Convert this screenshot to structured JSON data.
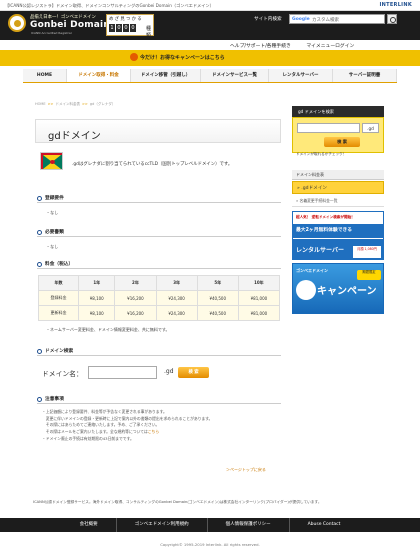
{
  "topbar": {
    "text": "【ICANN公認レジストラ】ドメイン取得、ドメインコンサルティングのGonbei Domain（ゴンベエドメイン）",
    "brand": "INTERLINK"
  },
  "logo": {
    "small": "品揃え日本一！ゴンベエドメイン",
    "main": "Gonbei Domain",
    "reg": "ICANN Accredited Registrar"
  },
  "counter": {
    "line1": "め ざ 見 つ か る",
    "digits": [
      "1",
      "0",
      "0",
      "0"
    ],
    "suffix": "種類"
  },
  "search": {
    "label": "サイト内検索",
    "engine": "Google",
    "placeholder": "カスタム検索"
  },
  "header_links": {
    "help": "ヘルプ/サポート/各種手続き",
    "mymenu": "マイメニューログイン"
  },
  "campaign": {
    "text": "今だけ！お得なキャンペーンはこちら"
  },
  "nav": [
    "HOME",
    "ドメイン取得・料金",
    "ドメイン移管（引越し）",
    "ドメインサービス一覧",
    "レンタルサーバー",
    "サーバー証明書"
  ],
  "breadcrumb": [
    "HOME",
    "ドメイン料金表",
    "gd（グレナダ）"
  ],
  "page_title": "gdドメイン",
  "description": ".gdはグレナダに割り当てられているccTLD（国別トップレベルドメイン）です。",
  "sections": {
    "registration_req": {
      "title": "登録要件",
      "body": "・なし"
    },
    "required_docs": {
      "title": "必要書類",
      "body": "・なし"
    },
    "pricing": {
      "title": "料金（税込）"
    },
    "domain_search": {
      "title": "ドメイン検索"
    },
    "notes": {
      "title": "注意事項"
    }
  },
  "price_table": {
    "header": [
      "年数",
      "1年",
      "2年",
      "3年",
      "5年",
      "10年"
    ],
    "rows": [
      [
        "登録料金",
        "¥8,100",
        "¥16,200",
        "¥24,300",
        "¥40,500",
        "¥81,000"
      ],
      [
        "更新料金",
        "¥8,100",
        "¥16,200",
        "¥24,300",
        "¥40,500",
        "¥81,000"
      ]
    ]
  },
  "price_note": "・ネームサーバー変更料金、ドメイン情報変更料金、共に無料です。",
  "domain_search": {
    "label": "ドメイン名：",
    "tld": ".gd",
    "button": "検 索"
  },
  "notes": [
    "・上記価額により登録要件、料金等が予告なく変更される事があります。",
    "　変更に伴いドメインの登録・更新時に上記で案内以外の書類の提出を求められることがあります。",
    "　その際にはあらためてご連絡いたします。予め、ご了承ください。"
  ],
  "notes_last": {
    "prefix": "・ドメイン廃止の手続は有効期限の43日前までです。"
  },
  "notes_link_line": {
    "prefix": "　その際はメールをご案内いたします。全な規約等については",
    "link": "こちら"
  },
  "page_top": "＞ページトップに戻る",
  "sidebar": {
    "search_head": "gd ドメインを検索",
    "tld": ".gd",
    "button": "検 索",
    "link": "ドメインが取れるかチェック！",
    "category": "ドメイン料金表",
    "active_item": "» .gdドメイン",
    "item": "» 名義変更手続料金一覧",
    "ad1": {
      "top": "超人気！ 逆転ドメイン検索が開始！",
      "mid": "最大2ヶ月無料体験できる",
      "bot": "レンタルサーバー",
      "price": "月額 1,080円"
    },
    "ad2": {
      "sub": "ゴンベエドメイン",
      "main": "キャンペーン",
      "badge": "期間限定"
    }
  },
  "footnote": "ICANN公認ドメイン登録サービス。海外ドメイン取得、コンサルティングのGonbei Domain(ゴンベエドメイン)は株式会社インターリンク(プロバイダー)が提供しています。",
  "footer": [
    "会社概要",
    "ゴンベエドメイン利用規約",
    "個人情報保護ポリシー",
    "Abuse Contact"
  ],
  "copyright": "Copyright© 1995-2019 Interlink. All rights reserved."
}
